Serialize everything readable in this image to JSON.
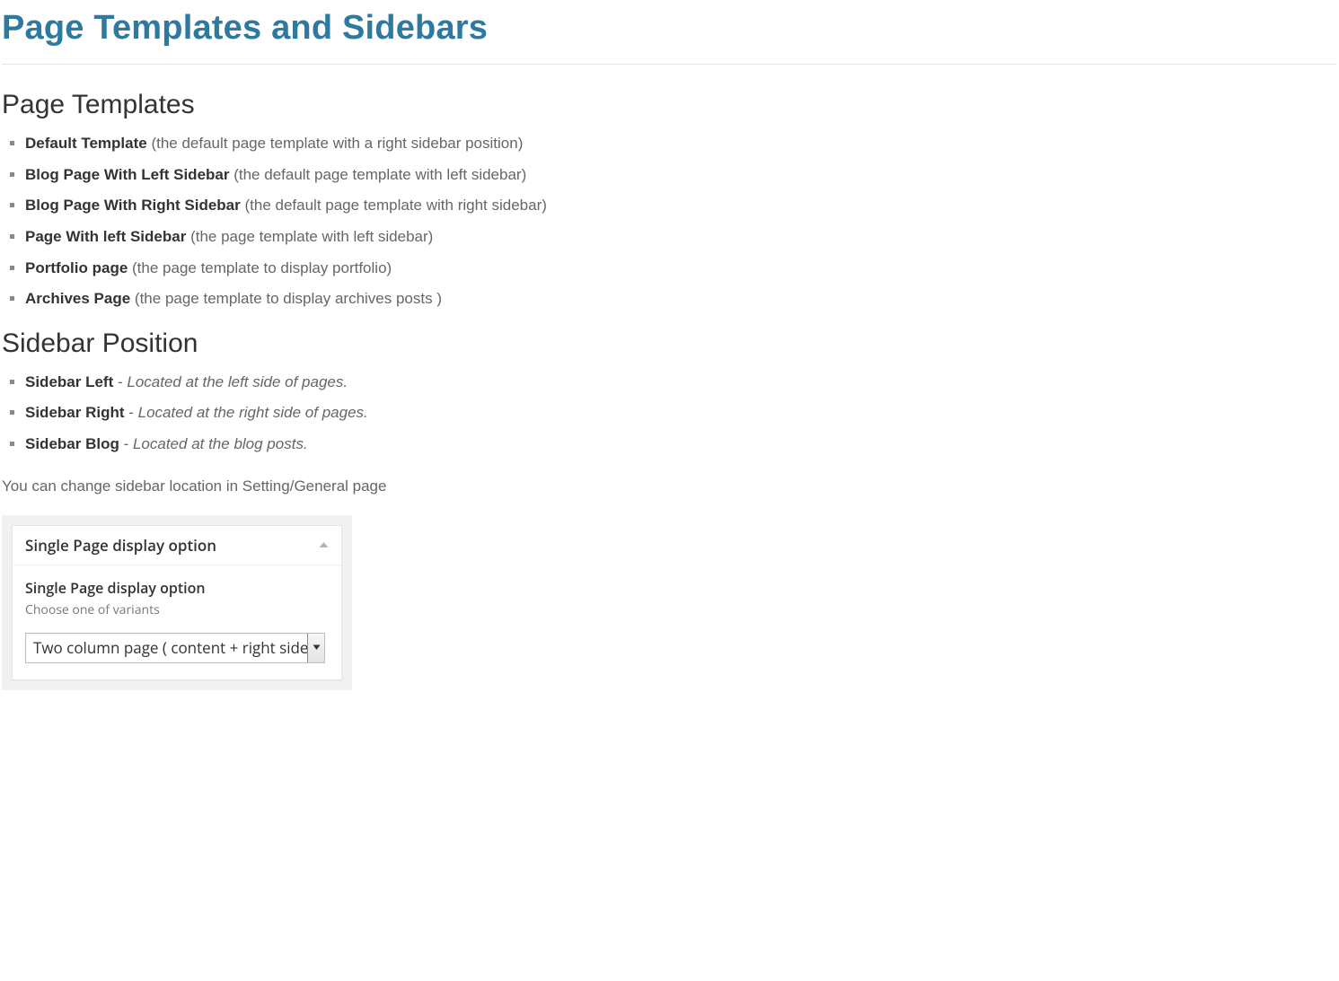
{
  "title": "Page Templates and Sidebars",
  "sections": {
    "templates": {
      "heading": "Page Templates",
      "items": [
        {
          "name": "Default Template",
          "desc": "(the default page template with a right sidebar position)"
        },
        {
          "name": "Blog Page With Left Sidebar",
          "desc": "(the default page template with left sidebar)"
        },
        {
          "name": "Blog Page With Right Sidebar",
          "desc": "(the default page template with right sidebar)"
        },
        {
          "name": "Page With left Sidebar",
          "desc": "(the page template with left sidebar)"
        },
        {
          "name": "Portfolio page",
          "desc": "(the page template to display portfolio)"
        },
        {
          "name": "Archives Page",
          "desc": "(the page template to display archives posts )"
        }
      ]
    },
    "positions": {
      "heading": "Sidebar Position",
      "items": [
        {
          "name": "Sidebar Left",
          "sep": " - ",
          "desc": "Located at the left side of pages."
        },
        {
          "name": "Sidebar Right",
          "sep": " - ",
          "desc": "Located at the right side of pages."
        },
        {
          "name": "Sidebar Blog",
          "sep": " - ",
          "desc": "Located at the blog posts."
        }
      ]
    }
  },
  "note": "You can change sidebar location in Setting/General page",
  "widget": {
    "header": "Single Page display option",
    "label": "Single Page display option",
    "hint": "Choose one of variants",
    "selected": "Two column page ( content + right sidebar)"
  }
}
